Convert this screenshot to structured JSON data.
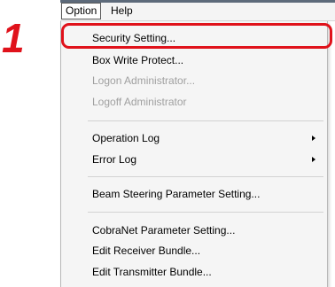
{
  "step": {
    "number": "1"
  },
  "menubar": {
    "items": [
      {
        "label": "Option"
      },
      {
        "label": "Help"
      }
    ]
  },
  "menu": {
    "items": [
      {
        "label": "Security Setting..."
      },
      {
        "label": "Box Write Protect..."
      },
      {
        "label": "Logon Administrator..."
      },
      {
        "label": "Logoff Administrator"
      },
      {
        "label": "Operation Log"
      },
      {
        "label": "Error Log"
      },
      {
        "label": "Beam Steering Parameter Setting..."
      },
      {
        "label": "CobraNet Parameter Setting..."
      },
      {
        "label": "Edit Receiver Bundle..."
      },
      {
        "label": "Edit Transmitter Bundle..."
      }
    ]
  },
  "colors": {
    "callout_red": "#e0121b",
    "disabled_text": "#a0a0a0",
    "menu_background": "#f5f5f5"
  }
}
